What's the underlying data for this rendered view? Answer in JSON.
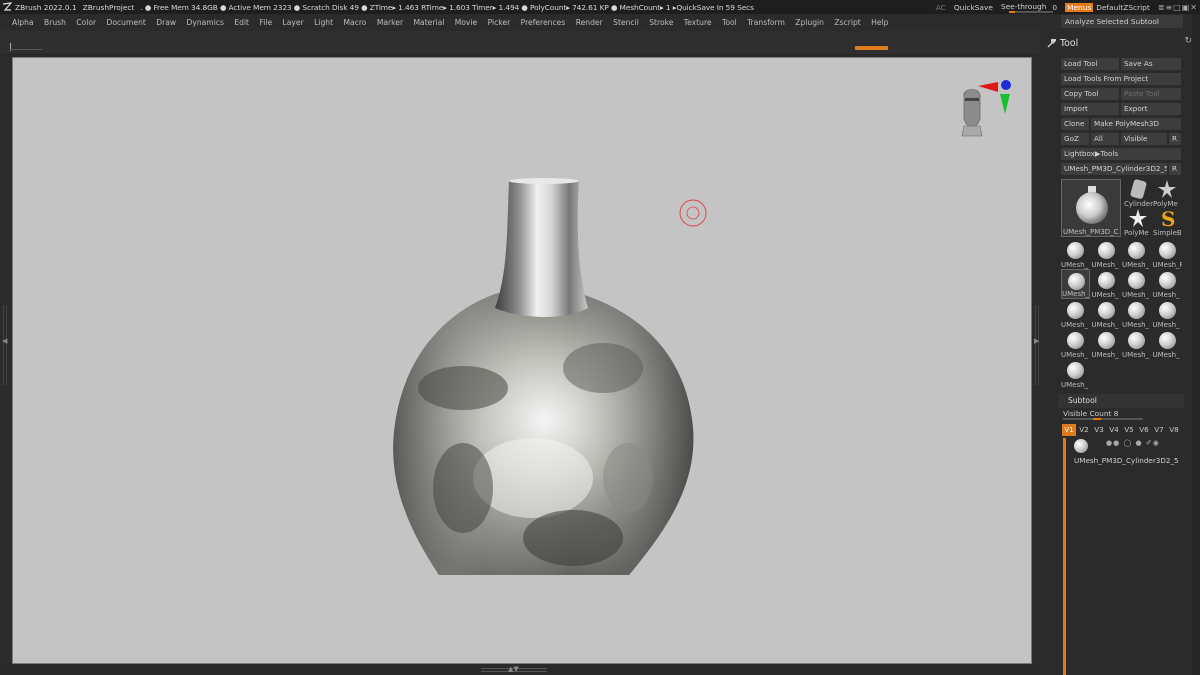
{
  "titlebar": {
    "app": "ZBrush 2022.0.1",
    "project": "ZBrushProject",
    "status": ". ● Free Mem 34.8GB ● Active Mem 2323 ● Scratch Disk 49 ●  ZTime▸ 1.463 RTime▸ 1.603 Timer▸ 1.494 ● PolyCount▸ 742.61 KP  ● MeshCount▸ 1   ▸QuickSave In 59 Secs",
    "ac": "AC",
    "quicksave": "QuickSave",
    "see_through_label": "See-through",
    "see_through_value": "0",
    "see_through_level": 0,
    "menus": "Menus",
    "zscript": "DefaultZScript"
  },
  "menu": [
    "Alpha",
    "Brush",
    "Color",
    "Document",
    "Draw",
    "Dynamics",
    "Edit",
    "File",
    "Layer",
    "Light",
    "Macro",
    "Marker",
    "Material",
    "Movie",
    "Picker",
    "Preferences",
    "Render",
    "Stencil",
    "Stroke",
    "Texture",
    "Tool",
    "Transform",
    "Zplugin",
    "Zscript",
    "Help"
  ],
  "panel": {
    "analyze": "Analyze Selected Subtool",
    "title": "Tool",
    "buttons": {
      "load_tool": "Load Tool",
      "save_as": "Save As",
      "load_from_project": "Load Tools From Project",
      "copy_tool": "Copy Tool",
      "paste_tool": "Paste Tool",
      "import": "Import",
      "export": "Export",
      "clone": "Clone",
      "make_polymesh": "Make PolyMesh3D",
      "goz": "GoZ",
      "all": "All",
      "visible": "Visible",
      "r": "R",
      "lightbox": "Lightbox▶Tools",
      "current_tool": "UMesh_PM3D_Cylinder3D2_5",
      "current_r": "R"
    },
    "big_thumb_label": "UMesh_PM3D_C",
    "small_thumbs": [
      "Cylinder",
      "PolyMe",
      "PolyMe",
      "SimpleB"
    ],
    "grid_thumbs": [
      "UMesh_",
      "UMesh_",
      "UMesh_",
      "UMesh_PM3D_C",
      "UMesh_",
      "UMesh_",
      "UMesh_",
      "UMesh_",
      "UMesh_",
      "UMesh_",
      "UMesh_",
      "UMesh_",
      "UMesh_",
      "UMesh_",
      "UMesh_",
      "UMesh_",
      "UMesh_"
    ],
    "subtool": {
      "header": "Subtool",
      "visible_count": "Visible Count 8",
      "tabs": [
        "V1",
        "V2",
        "V3",
        "V4",
        "V5",
        "V6",
        "V7",
        "V8"
      ],
      "item_name": "UMesh_PM3D_Cylinder3D2_5"
    }
  },
  "colors": {
    "accent": "#e07a1b",
    "canvas": "#c4c4c4",
    "panel": "#2b2b2b"
  }
}
